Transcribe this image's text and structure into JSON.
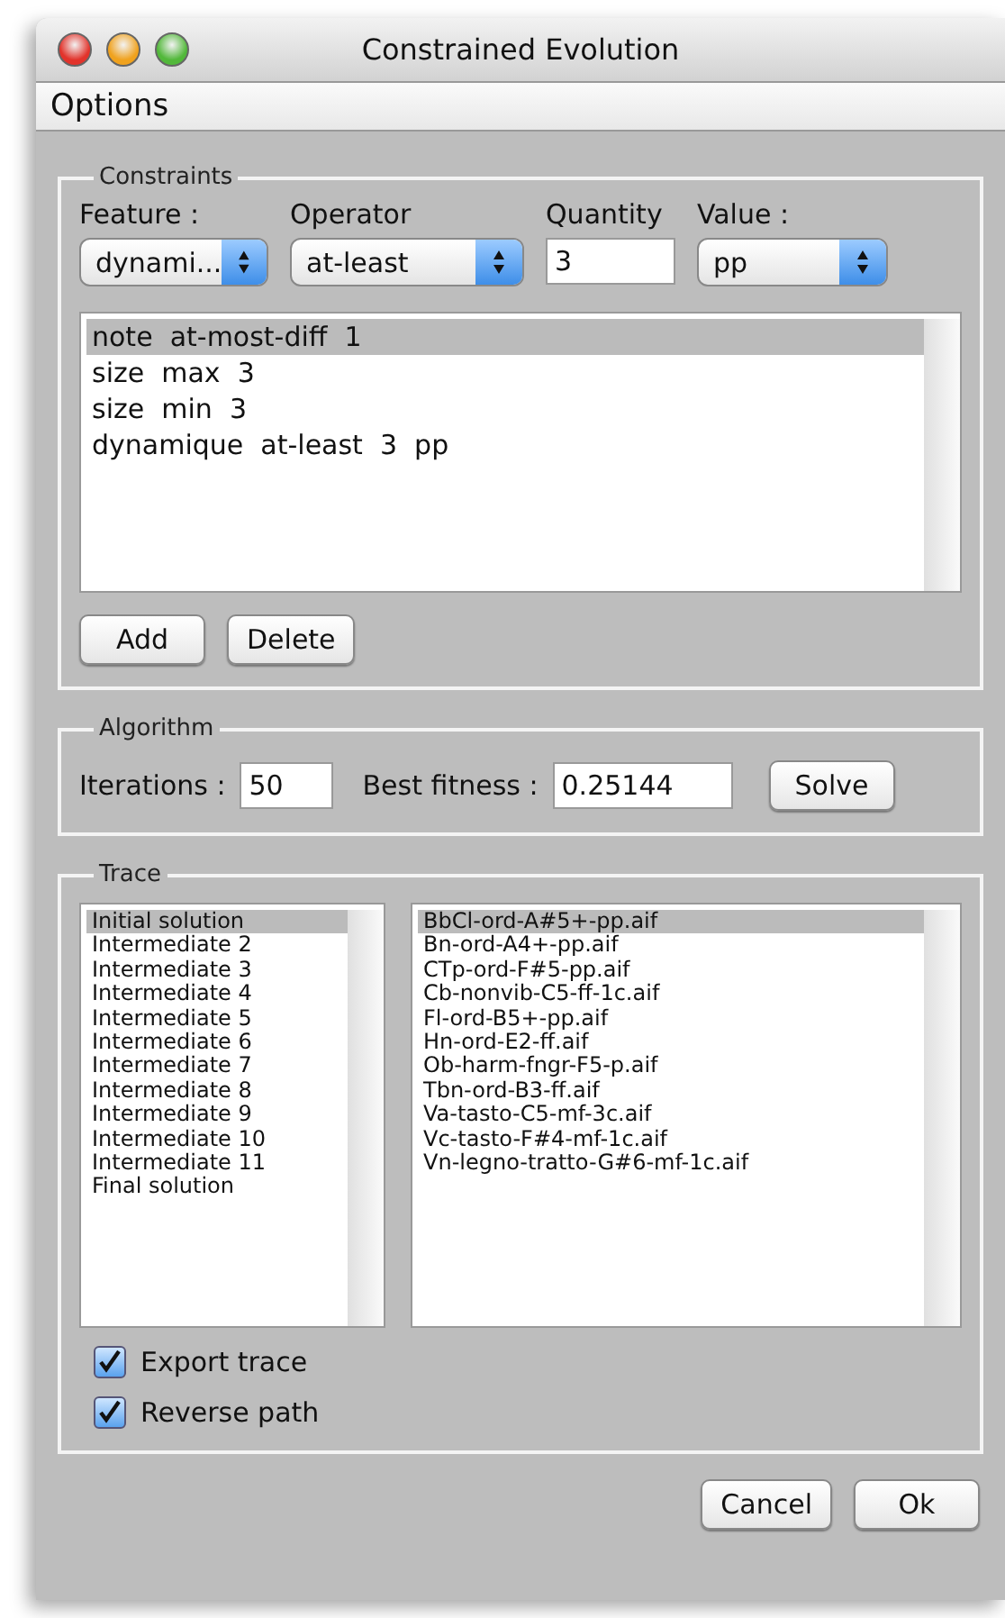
{
  "window": {
    "title": "Constrained Evolution"
  },
  "menu": [
    "Options"
  ],
  "constraints": {
    "title": "Constraints",
    "fields": [
      {
        "label": "Feature :",
        "kind": "select",
        "value": "dynami..."
      },
      {
        "label": "Operator",
        "kind": "select",
        "value": "at-least"
      },
      {
        "label": "Quantity",
        "kind": "text",
        "value": "3"
      },
      {
        "label": "Value :",
        "kind": "select",
        "value": "pp"
      }
    ],
    "list": [
      {
        "text": "note  at-most-diff  1",
        "selected": true
      },
      {
        "text": "size  max  3",
        "selected": false
      },
      {
        "text": "size  min  3",
        "selected": false
      },
      {
        "text": "dynamique  at-least  3  pp",
        "selected": false
      }
    ],
    "buttons": [
      "Add",
      "Delete"
    ]
  },
  "algorithm": {
    "title": "Algorithm",
    "iterations_label": "Iterations :",
    "iterations": "50",
    "fitness_label": "Best fitness :",
    "fitness": "0.25144",
    "button": "Solve"
  },
  "trace": {
    "title": "Trace",
    "steps": [
      {
        "text": "Initial solution",
        "selected": true
      },
      {
        "text": "Intermediate 2",
        "selected": false
      },
      {
        "text": "Intermediate 3",
        "selected": false
      },
      {
        "text": "Intermediate 4",
        "selected": false
      },
      {
        "text": "Intermediate 5",
        "selected": false
      },
      {
        "text": "Intermediate 6",
        "selected": false
      },
      {
        "text": "Intermediate 7",
        "selected": false
      },
      {
        "text": "Intermediate 8",
        "selected": false
      },
      {
        "text": "Intermediate 9",
        "selected": false
      },
      {
        "text": "Intermediate 10",
        "selected": false
      },
      {
        "text": "Intermediate 11",
        "selected": false
      },
      {
        "text": "Final solution",
        "selected": false
      }
    ],
    "files": [
      {
        "text": "BbCl-ord-A#5+-pp.aif",
        "selected": true
      },
      {
        "text": "Bn-ord-A4+-pp.aif",
        "selected": false
      },
      {
        "text": "CTp-ord-F#5-pp.aif",
        "selected": false
      },
      {
        "text": "Cb-nonvib-C5-ff-1c.aif",
        "selected": false
      },
      {
        "text": "Fl-ord-B5+-pp.aif",
        "selected": false
      },
      {
        "text": "Hn-ord-E2-ff.aif",
        "selected": false
      },
      {
        "text": "Ob-harm-fngr-F5-p.aif",
        "selected": false
      },
      {
        "text": "Tbn-ord-B3-ff.aif",
        "selected": false
      },
      {
        "text": "Va-tasto-C5-mf-3c.aif",
        "selected": false
      },
      {
        "text": "Vc-tasto-F#4-mf-1c.aif",
        "selected": false
      },
      {
        "text": "Vn-legno-tratto-G#6-mf-1c.aif",
        "selected": false
      }
    ],
    "options": [
      {
        "label": "Export trace",
        "checked": true
      },
      {
        "label": "Reverse path",
        "checked": true
      }
    ]
  },
  "footer": [
    "Cancel",
    "Ok"
  ]
}
